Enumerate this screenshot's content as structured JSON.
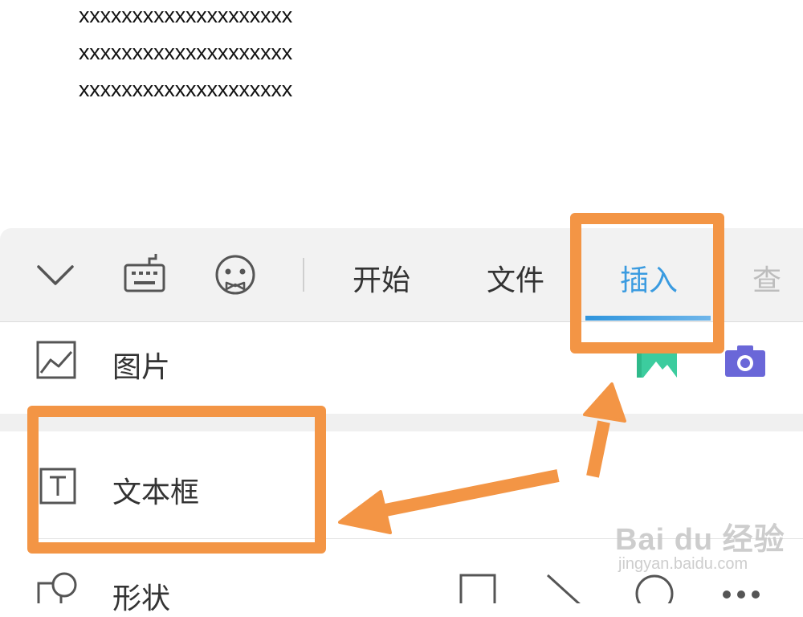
{
  "document": {
    "lines": [
      "xxxxxxxxxxxxxxxxxxxx",
      "xxxxxxxxxxxxxxxxxxxx",
      "xxxxxxxxxxxxxxxxxxxx"
    ]
  },
  "toolbar": {
    "icons": [
      "chevron-down-icon",
      "keyboard-icon",
      "emoji-icon"
    ],
    "tabs": [
      {
        "label": "开始",
        "active": false
      },
      {
        "label": "文件",
        "active": false
      },
      {
        "label": "插入",
        "active": true
      },
      {
        "label": "查",
        "active": false
      }
    ],
    "accent_color": "#3a9be0"
  },
  "insert_menu": {
    "items": [
      {
        "label": "图片",
        "icon": "image-icon",
        "actions": [
          "gallery-icon",
          "camera-icon"
        ]
      },
      {
        "label": "文本框",
        "icon": "textbox-icon"
      },
      {
        "label": "形状",
        "icon": "shape-icon",
        "actions": [
          "rectangle-icon",
          "line-icon",
          "circle-icon",
          "more-icon"
        ]
      }
    ]
  },
  "annotations": {
    "highlight_color": "#f39545"
  },
  "watermark": {
    "main": "Bai du 经验",
    "sub": "jingyan.baidu.com"
  }
}
